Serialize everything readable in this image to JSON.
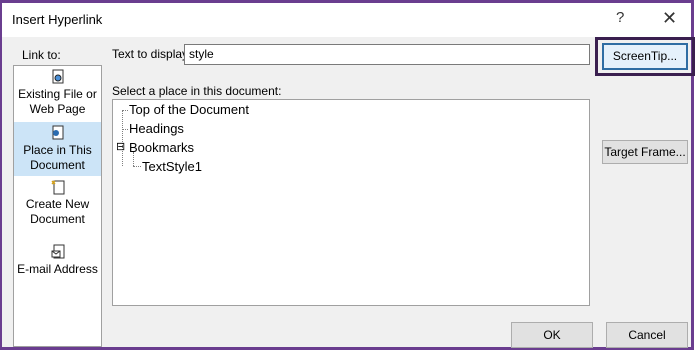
{
  "dialog": {
    "title": "Insert Hyperlink",
    "help_label": "?",
    "close_label": "✕"
  },
  "link_to": {
    "label": "Link to:",
    "items": [
      {
        "label": "Existing File or Web Page",
        "icon": "existing-file-icon"
      },
      {
        "label": "Place in This Document",
        "icon": "place-in-document-icon",
        "selected": true
      },
      {
        "label": "Create New Document",
        "icon": "new-document-icon"
      },
      {
        "label": "E-mail Address",
        "icon": "email-icon"
      }
    ]
  },
  "text_to_display": {
    "label": "Text to display:",
    "value": "style"
  },
  "place": {
    "label": "Select a place in this document:",
    "tree": [
      {
        "label": "Top of the Document"
      },
      {
        "label": "Headings"
      },
      {
        "label": "Bookmarks",
        "expanded": true,
        "toggle": "⊟"
      },
      {
        "label": "TextStyle1"
      }
    ]
  },
  "buttons": {
    "screentip": "ScreenTip...",
    "target_frame": "Target Frame...",
    "ok": "OK",
    "cancel": "Cancel"
  },
  "colors": {
    "selected_bg": "#cce4f7",
    "highlight_frame": "#3a1f4f",
    "dialog_bg": "#f0f0f0"
  }
}
